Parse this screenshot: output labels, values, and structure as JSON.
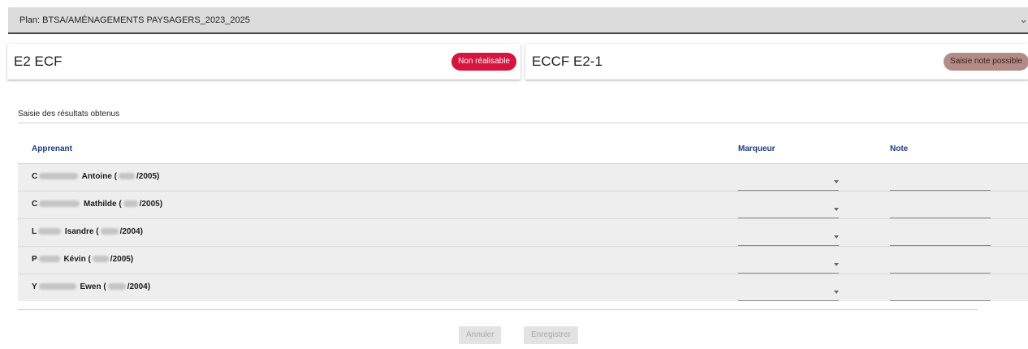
{
  "plan": {
    "label": "Plan: BTSA/AMÉNAGEMENTS PAYSAGERS_2023_2025",
    "expand_icon": "chevron-down-icon"
  },
  "cards": {
    "left": {
      "title": "E2 ECF",
      "badge": "Non réalisable",
      "badge_color": "#d6153f"
    },
    "right": {
      "title": "ECCF E2-1",
      "badge": "Saisie note possible",
      "badge_color": "#b38b87"
    }
  },
  "section": {
    "title": "Saisie des résultats obtenus"
  },
  "table": {
    "headers": {
      "apprenant": "Apprenant",
      "marqueur": "Marqueur",
      "note": "Note"
    },
    "rows": [
      {
        "initial": "C",
        "first_name": "Antoine (",
        "year": "/2005)",
        "marqueur": "",
        "note": ""
      },
      {
        "initial": "C",
        "first_name": "Mathilde (",
        "year": "/2005)",
        "marqueur": "",
        "note": ""
      },
      {
        "initial": "L",
        "first_name": "Isandre (",
        "year": "/2004)",
        "marqueur": "",
        "note": ""
      },
      {
        "initial": "P",
        "first_name": "Kévin (",
        "year": "/2005)",
        "marqueur": "",
        "note": ""
      },
      {
        "initial": "Y",
        "first_name": "Ewen (",
        "year": "/2004)",
        "marqueur": "",
        "note": ""
      }
    ]
  },
  "actions": {
    "cancel": "Annuler",
    "save": "Enregistrer"
  }
}
